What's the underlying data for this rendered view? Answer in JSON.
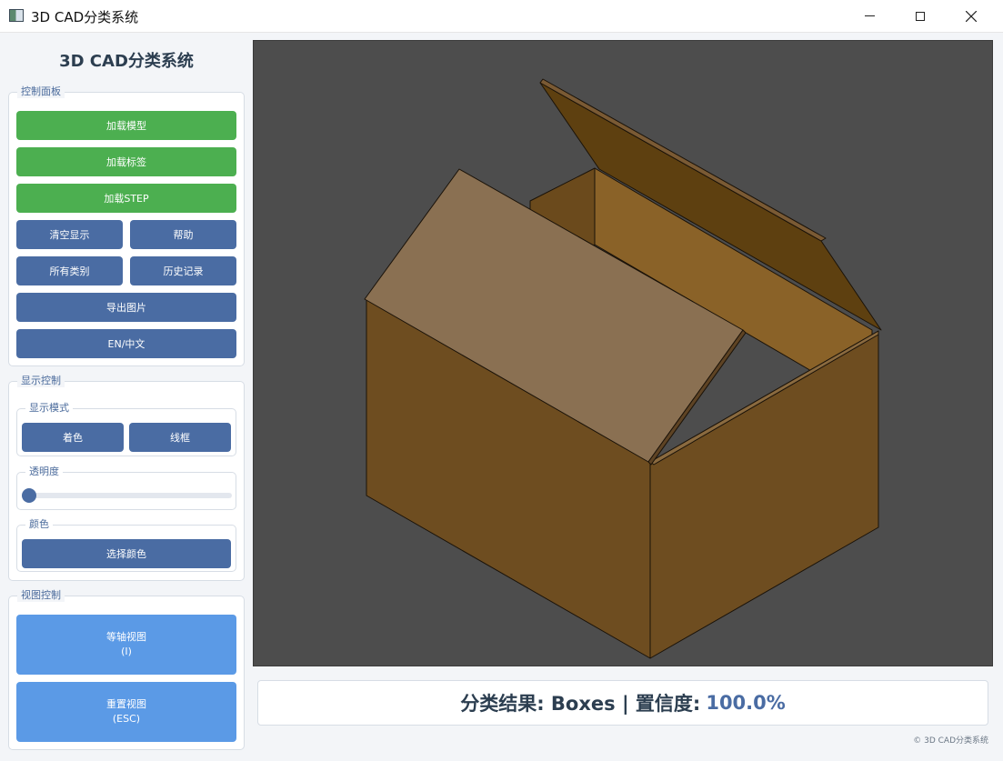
{
  "window": {
    "title": "3D CAD分类系统"
  },
  "sidebar": {
    "heading": "3D CAD分类系统",
    "control_panel": {
      "title": "控制面板",
      "load_model": "加载模型",
      "load_labels": "加载标签",
      "load_step": "加载STEP",
      "clear_display": "清空显示",
      "help": "帮助",
      "all_categories": "所有类别",
      "history": "历史记录",
      "export_image": "导出图片",
      "language": "EN/中文"
    },
    "display_control": {
      "title": "显示控制",
      "mode_title": "显示模式",
      "shaded": "着色",
      "wireframe": "线框",
      "transparency_title": "透明度",
      "transparency_value": 0,
      "color_title": "颜色",
      "choose_color": "选择颜色"
    },
    "view_control": {
      "title": "视图控制",
      "iso_view": "等轴视图",
      "iso_view_key": "(I)",
      "reset_view": "重置视图",
      "reset_view_key": "(ESC)"
    }
  },
  "viewport": {
    "background": "#4d4d4d",
    "model": "open cardboard box"
  },
  "result": {
    "label": "分类结果: Boxes | 置信度:",
    "confidence": "100.0%"
  },
  "footer": {
    "text": "© 3D CAD分类系统"
  },
  "colors": {
    "accent_green": "#4caf50",
    "accent_blue": "#4a6ca3",
    "light_blue": "#5b9ae6"
  }
}
